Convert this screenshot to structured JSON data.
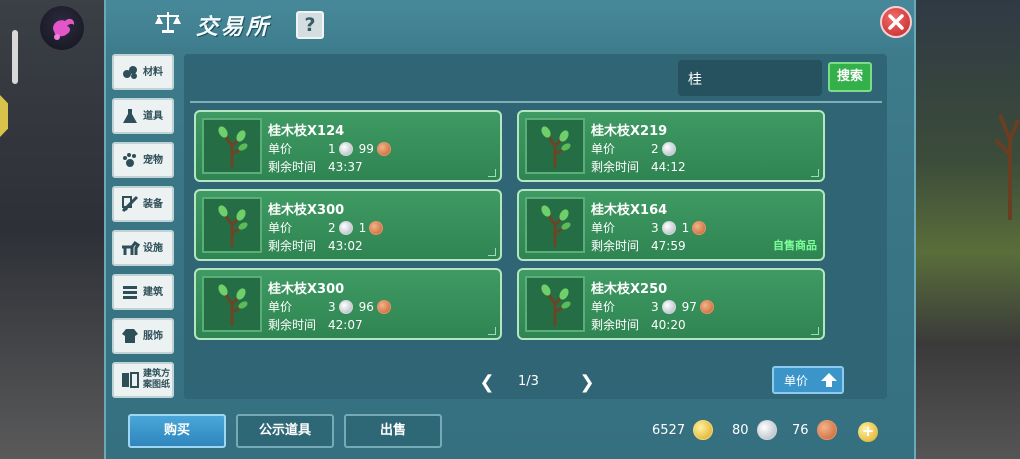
{
  "window": {
    "title": "交易所",
    "help": "?"
  },
  "categories": [
    {
      "label": "材料",
      "icon": "material-icon"
    },
    {
      "label": "道具",
      "icon": "flask-icon"
    },
    {
      "label": "宠物",
      "icon": "paw-icon"
    },
    {
      "label": "装备",
      "icon": "sword-icon"
    },
    {
      "label": "设施",
      "icon": "horse-icon"
    },
    {
      "label": "建筑",
      "icon": "building-icon"
    },
    {
      "label": "服饰",
      "icon": "clothes-icon"
    },
    {
      "label": "建筑方案图纸",
      "icon": "blueprint-icon"
    }
  ],
  "search": {
    "value": "桂",
    "button": "搜索"
  },
  "listing": {
    "price_label": "单价",
    "time_label": "剩余时间",
    "items": [
      {
        "name": "桂木枝X124",
        "silver": "1",
        "copper": "99",
        "time": "43:37",
        "self": ""
      },
      {
        "name": "桂木枝X219",
        "silver": "2",
        "copper": "",
        "time": "44:12",
        "self": ""
      },
      {
        "name": "桂木枝X300",
        "silver": "2",
        "copper": "1",
        "time": "43:02",
        "self": ""
      },
      {
        "name": "桂木枝X164",
        "silver": "3",
        "copper": "1",
        "time": "47:59",
        "self": "自售商品"
      },
      {
        "name": "桂木枝X300",
        "silver": "3",
        "copper": "96",
        "time": "42:07",
        "self": ""
      },
      {
        "name": "桂木枝X250",
        "silver": "3",
        "copper": "97",
        "time": "40:20",
        "self": ""
      }
    ]
  },
  "pager": {
    "text": "1/3"
  },
  "sort": {
    "label": "单价"
  },
  "tabs": {
    "buy": "购买",
    "public": "公示道具",
    "sell": "出售"
  },
  "wallet": {
    "gold": "6527",
    "silver": "80",
    "copper": "76"
  },
  "colors": {
    "panel": "#2f6574",
    "card": "#3f9a63",
    "accent": "#3b95c8",
    "search": "#33b04a"
  }
}
